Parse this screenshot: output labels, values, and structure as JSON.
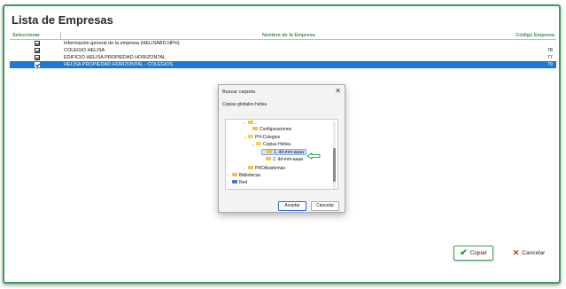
{
  "window": {
    "title": "Lista de Empresas"
  },
  "table": {
    "headers": {
      "select": "Seleccionar",
      "name": "Nombre de la Empresa",
      "code": "Código Empresa"
    },
    "rows": [
      {
        "name": "Información general de la empresa (HELISABD.HPH)",
        "code": ""
      },
      {
        "name": "COLEGIO HELISA",
        "code": "78"
      },
      {
        "name": "EDIFICIO HELISA PROPIEDAD HORIZONTAL",
        "code": "77"
      },
      {
        "name": "HELISA PROPIEDAD HORIZONTAL - COLEGIOS",
        "code": "79"
      }
    ]
  },
  "dialog": {
    "title": "Buscar carpeta",
    "close": "✕",
    "description": "Copias globales helisa",
    "tree": [
      {
        "label": "..",
        "chevron": "›"
      },
      {
        "label": "Configuraciones",
        "chevron": ""
      },
      {
        "label": "PH-Colegios",
        "chevron": "⌄"
      },
      {
        "label": "Copias Helisa",
        "chevron": "⌄"
      },
      {
        "label": "1. dd-mm-aaaa",
        "chevron": ""
      },
      {
        "label": "2. dd-mm-aaaa",
        "chevron": ""
      },
      {
        "label": "PROAsistemas",
        "chevron": "›"
      },
      {
        "label": "Bibliotecas",
        "chevron": "›"
      },
      {
        "label": "Red",
        "chevron": "›"
      }
    ],
    "accept_label": "Aceptar",
    "cancel_label": "Cancelar"
  },
  "footer": {
    "copy_label": "Copiar",
    "cancel_label": "Cancelar"
  },
  "colors": {
    "accent_green": "#3f9a57",
    "selection_blue": "#1e78d7"
  }
}
